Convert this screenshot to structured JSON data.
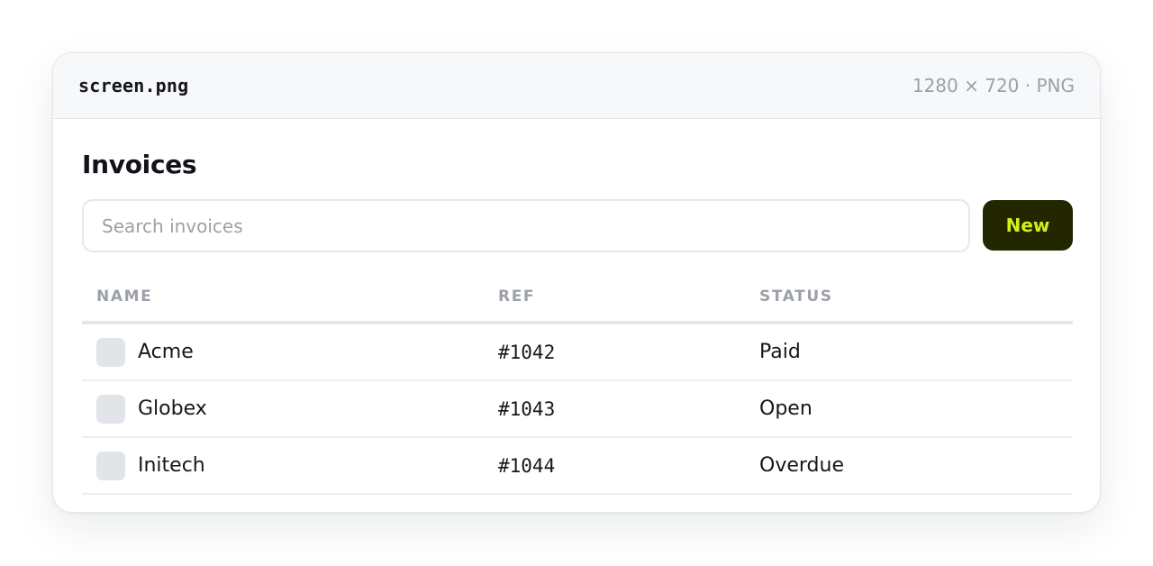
{
  "file": {
    "name": "screen.png",
    "meta": "1280 × 720 · PNG"
  },
  "page": {
    "title": "Invoices"
  },
  "search": {
    "placeholder": "Search invoices",
    "value": ""
  },
  "toolbar": {
    "new_label": "New"
  },
  "colors": {
    "new_button_bg": "#222700",
    "new_button_text": "#d4ef1c"
  },
  "table": {
    "columns": [
      "NAME",
      "REF",
      "STATUS"
    ],
    "rows": [
      {
        "name": "Acme",
        "ref": "#1042",
        "status": "Paid",
        "checked": false
      },
      {
        "name": "Globex",
        "ref": "#1043",
        "status": "Open",
        "checked": false
      },
      {
        "name": "Initech",
        "ref": "#1044",
        "status": "Overdue",
        "checked": false
      }
    ]
  }
}
